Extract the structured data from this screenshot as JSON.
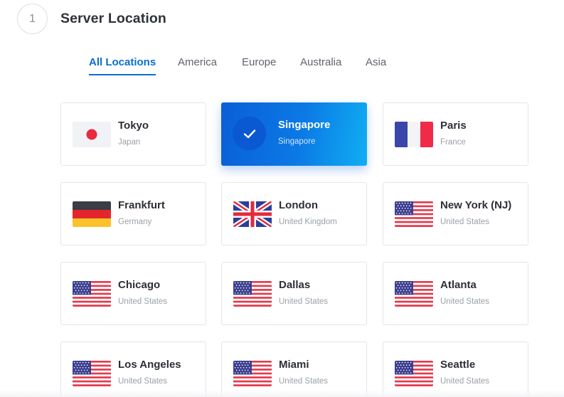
{
  "step": {
    "number": "1",
    "title": "Server Location"
  },
  "tabs": [
    {
      "label": "All Locations",
      "active": true
    },
    {
      "label": "America",
      "active": false
    },
    {
      "label": "Europe",
      "active": false
    },
    {
      "label": "Australia",
      "active": false
    },
    {
      "label": "Asia",
      "active": false
    }
  ],
  "colors": {
    "accent": "#0a6ed1",
    "selected_gradient_start": "#0a5ed7",
    "selected_gradient_end": "#10aef3"
  },
  "locations": [
    {
      "city": "Tokyo",
      "country": "Japan",
      "flag": "japan-flag-icon",
      "selected": false
    },
    {
      "city": "Singapore",
      "country": "Singapore",
      "flag": "checkmark-icon",
      "selected": true
    },
    {
      "city": "Paris",
      "country": "France",
      "flag": "france-flag-icon",
      "selected": false
    },
    {
      "city": "Frankfurt",
      "country": "Germany",
      "flag": "germany-flag-icon",
      "selected": false
    },
    {
      "city": "London",
      "country": "United Kingdom",
      "flag": "uk-flag-icon",
      "selected": false
    },
    {
      "city": "New York (NJ)",
      "country": "United States",
      "flag": "us-flag-icon",
      "selected": false
    },
    {
      "city": "Chicago",
      "country": "United States",
      "flag": "us-flag-icon",
      "selected": false
    },
    {
      "city": "Dallas",
      "country": "United States",
      "flag": "us-flag-icon",
      "selected": false
    },
    {
      "city": "Atlanta",
      "country": "United States",
      "flag": "us-flag-icon",
      "selected": false
    },
    {
      "city": "Los Angeles",
      "country": "United States",
      "flag": "us-flag-icon",
      "selected": false
    },
    {
      "city": "Miami",
      "country": "United States",
      "flag": "us-flag-icon",
      "selected": false
    },
    {
      "city": "Seattle",
      "country": "United States",
      "flag": "us-flag-icon",
      "selected": false
    }
  ]
}
